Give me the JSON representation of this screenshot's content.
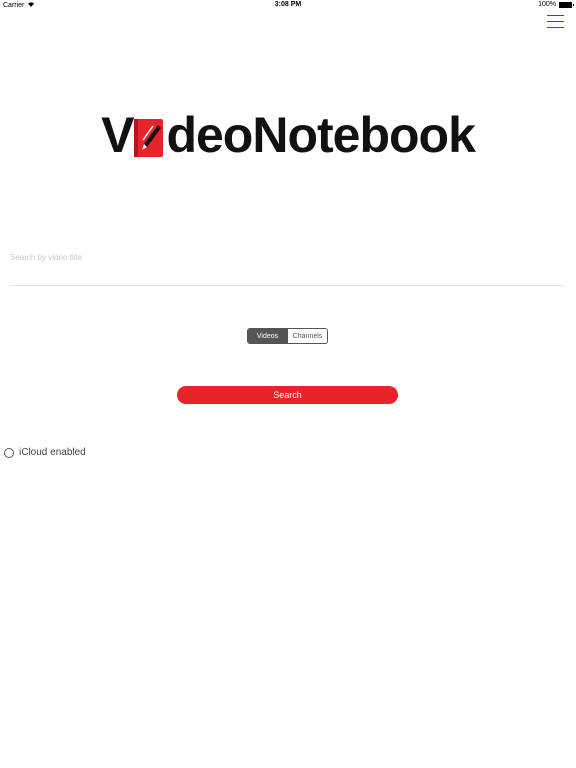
{
  "status_bar": {
    "carrier": "Carrier",
    "wifi_icon": "wifi-icon",
    "time": "3:08 PM",
    "battery_percent": "100%",
    "battery_level": 1.0
  },
  "header": {
    "menu_icon": "hamburger-menu-icon",
    "menu_color": "#2d4ea8"
  },
  "logo": {
    "text_before": "V",
    "text_after": "deoNotebook",
    "icon": "pencil-notebook-icon",
    "accent_color": "#e8232a"
  },
  "search": {
    "placeholder": "Search by video title",
    "value": ""
  },
  "segmented": {
    "options": [
      "Videos",
      "Channels"
    ],
    "selected": "Videos"
  },
  "search_button": {
    "label": "Search",
    "color": "#e8232a"
  },
  "icloud": {
    "label": "iCloud enabled",
    "checked": false
  }
}
